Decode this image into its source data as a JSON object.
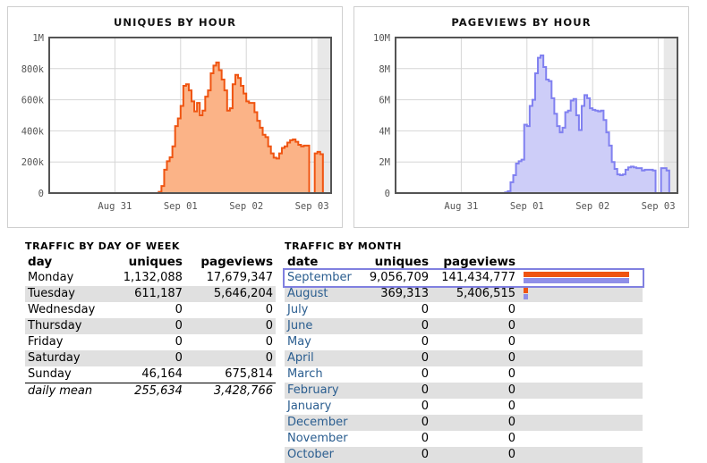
{
  "charts": [
    {
      "id": "uniques-by-hour",
      "title": "UNIQUES BY HOUR",
      "line_color": "#ef5411",
      "fill_color": "#fbb387",
      "y_ticks": [
        "1M",
        "800k",
        "600k",
        "400k",
        "200k",
        "0"
      ],
      "x_ticks": [
        "Aug 31",
        "Sep 01",
        "Sep 02",
        "Sep 03"
      ]
    },
    {
      "id": "pageviews-by-hour",
      "title": "PAGEVIEWS BY HOUR",
      "line_color": "#8080f0",
      "fill_color": "#cdcdf8",
      "y_ticks": [
        "10M",
        "8M",
        "6M",
        "4M",
        "2M",
        "0"
      ],
      "x_ticks": [
        "Aug 31",
        "Sep 01",
        "Sep 02",
        "Sep 03"
      ]
    }
  ],
  "chart_data": [
    {
      "type": "area",
      "title": "UNIQUES BY HOUR",
      "xlabel": "",
      "ylabel": "uniques",
      "ylim": [
        0,
        1000000
      ],
      "ytick_values": [
        0,
        200000,
        400000,
        600000,
        800000,
        1000000
      ],
      "ytick_labels": [
        "0",
        "200k",
        "400k",
        "600k",
        "800k",
        "1M"
      ],
      "xtick_labels": [
        "Aug 31",
        "Sep 01",
        "Sep 02",
        "Sep 03"
      ],
      "xtick_index": [
        24,
        48,
        72,
        96
      ],
      "grid": true,
      "line_color": "#ef5411",
      "fill_color": "#fbb387",
      "x_unit": "hour",
      "x_count": 104,
      "values": [
        0,
        0,
        0,
        0,
        0,
        0,
        0,
        0,
        0,
        0,
        0,
        0,
        0,
        0,
        0,
        0,
        0,
        0,
        0,
        0,
        0,
        0,
        0,
        0,
        0,
        0,
        0,
        0,
        0,
        0,
        0,
        0,
        0,
        0,
        0,
        0,
        0,
        0,
        0,
        0,
        8000,
        45000,
        150000,
        205000,
        230000,
        300000,
        430000,
        480000,
        560000,
        690000,
        700000,
        660000,
        590000,
        525000,
        580000,
        500000,
        530000,
        620000,
        660000,
        770000,
        820000,
        840000,
        790000,
        730000,
        660000,
        530000,
        545000,
        700000,
        760000,
        740000,
        690000,
        640000,
        590000,
        580000,
        580000,
        520000,
        465000,
        420000,
        375000,
        360000,
        300000,
        255000,
        228000,
        222000,
        255000,
        290000,
        300000,
        325000,
        340000,
        345000,
        330000,
        310000,
        300000,
        305000,
        305000,
        0,
        0,
        255000,
        265000,
        250000,
        0,
        0,
        0,
        0
      ]
    },
    {
      "type": "area",
      "title": "PAGEVIEWS BY HOUR",
      "xlabel": "",
      "ylabel": "pageviews",
      "ylim": [
        0,
        10000000
      ],
      "ytick_values": [
        0,
        2000000,
        4000000,
        6000000,
        8000000,
        10000000
      ],
      "ytick_labels": [
        "0",
        "2M",
        "4M",
        "6M",
        "8M",
        "10M"
      ],
      "xtick_labels": [
        "Aug 31",
        "Sep 01",
        "Sep 02",
        "Sep 03"
      ],
      "xtick_index": [
        24,
        48,
        72,
        96
      ],
      "grid": true,
      "line_color": "#8080f0",
      "fill_color": "#cdcdf8",
      "x_unit": "hour",
      "x_count": 104,
      "values": [
        0,
        0,
        0,
        0,
        0,
        0,
        0,
        0,
        0,
        0,
        0,
        0,
        0,
        0,
        0,
        0,
        0,
        0,
        0,
        0,
        0,
        0,
        0,
        0,
        0,
        0,
        0,
        0,
        0,
        0,
        0,
        0,
        0,
        0,
        0,
        0,
        0,
        0,
        0,
        0,
        40000,
        120000,
        700000,
        1150000,
        1900000,
        2050000,
        2150000,
        4400000,
        4300000,
        5600000,
        6000000,
        7700000,
        8700000,
        8850000,
        8100000,
        7300000,
        7200000,
        6100000,
        5100000,
        4300000,
        3900000,
        4200000,
        5200000,
        5300000,
        5950000,
        6050000,
        5000000,
        4050000,
        5600000,
        6300000,
        6100000,
        5450000,
        5350000,
        5300000,
        5250000,
        5300000,
        4700000,
        3900000,
        3050000,
        2000000,
        1550000,
        1200000,
        1150000,
        1200000,
        1500000,
        1650000,
        1700000,
        1650000,
        1600000,
        1600000,
        1450000,
        1500000,
        1500000,
        1500000,
        1450000,
        0,
        0,
        1600000,
        1600000,
        1450000,
        0,
        0,
        0,
        0
      ]
    }
  ],
  "day_table": {
    "caption": "TRAFFIC BY DAY OF WEEK",
    "columns": [
      "day",
      "uniques",
      "pageviews"
    ],
    "rows": [
      {
        "day": "Monday",
        "uniques": "1,132,088",
        "pageviews": "17,679,347"
      },
      {
        "day": "Tuesday",
        "uniques": "611,187",
        "pageviews": "5,646,204"
      },
      {
        "day": "Wednesday",
        "uniques": "0",
        "pageviews": "0"
      },
      {
        "day": "Thursday",
        "uniques": "0",
        "pageviews": "0"
      },
      {
        "day": "Friday",
        "uniques": "0",
        "pageviews": "0"
      },
      {
        "day": "Saturday",
        "uniques": "0",
        "pageviews": "0"
      },
      {
        "day": "Sunday",
        "uniques": "46,164",
        "pageviews": "675,814"
      }
    ],
    "summary": {
      "label": "daily mean",
      "uniques": "255,634",
      "pageviews": "3,428,766"
    }
  },
  "month_table": {
    "caption": "TRAFFIC BY MONTH",
    "columns": [
      "date",
      "uniques",
      "pageviews"
    ],
    "rows": [
      {
        "date": "September",
        "uniques": "9,056,709",
        "pageviews": "141,434,777",
        "uniques_pct": 100,
        "pageviews_pct": 100,
        "selected": true
      },
      {
        "date": "August",
        "uniques": "369,313",
        "pageviews": "5,406,515",
        "uniques_pct": 4,
        "pageviews_pct": 4,
        "selected": false
      },
      {
        "date": "July",
        "uniques": "0",
        "pageviews": "0",
        "uniques_pct": 0,
        "pageviews_pct": 0,
        "selected": false
      },
      {
        "date": "June",
        "uniques": "0",
        "pageviews": "0",
        "uniques_pct": 0,
        "pageviews_pct": 0,
        "selected": false
      },
      {
        "date": "May",
        "uniques": "0",
        "pageviews": "0",
        "uniques_pct": 0,
        "pageviews_pct": 0,
        "selected": false
      },
      {
        "date": "April",
        "uniques": "0",
        "pageviews": "0",
        "uniques_pct": 0,
        "pageviews_pct": 0,
        "selected": false
      },
      {
        "date": "March",
        "uniques": "0",
        "pageviews": "0",
        "uniques_pct": 0,
        "pageviews_pct": 0,
        "selected": false
      },
      {
        "date": "February",
        "uniques": "0",
        "pageviews": "0",
        "uniques_pct": 0,
        "pageviews_pct": 0,
        "selected": false
      },
      {
        "date": "January",
        "uniques": "0",
        "pageviews": "0",
        "uniques_pct": 0,
        "pageviews_pct": 0,
        "selected": false
      },
      {
        "date": "December",
        "uniques": "0",
        "pageviews": "0",
        "uniques_pct": 0,
        "pageviews_pct": 0,
        "selected": false
      },
      {
        "date": "November",
        "uniques": "0",
        "pageviews": "0",
        "uniques_pct": 0,
        "pageviews_pct": 0,
        "selected": false
      },
      {
        "date": "October",
        "uniques": "0",
        "pageviews": "0",
        "uniques_pct": 0,
        "pageviews_pct": 0,
        "selected": false
      }
    ]
  },
  "colors": {
    "orange_line": "#ef5411",
    "orange_fill": "#fbb387",
    "purple_line": "#8080f0",
    "purple_fill": "#cdcdf8",
    "link": "#2a5d8f",
    "row_alt": "#e0e0e0",
    "plot_border": "#545454",
    "grid": "#d6d6d6",
    "nodata_band": "#e8e8e8",
    "select_border": "#8080e0"
  }
}
